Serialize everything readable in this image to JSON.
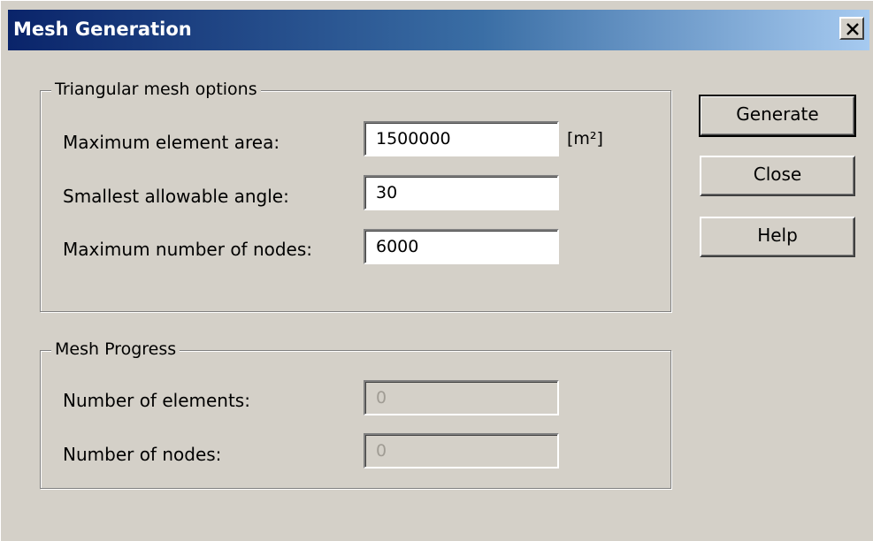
{
  "window": {
    "title": "Mesh Generation",
    "close_glyph": "×"
  },
  "triangular_group": {
    "legend": "Triangular mesh options",
    "fields": [
      {
        "label": "Maximum element area:",
        "value": "1500000",
        "unit": "[m²]"
      },
      {
        "label": "Smallest allowable angle:",
        "value": "30"
      },
      {
        "label": "Maximum number of nodes:",
        "value": "6000"
      }
    ]
  },
  "progress_group": {
    "legend": "Mesh Progress",
    "fields": [
      {
        "label": "Number of elements:",
        "value": "0"
      },
      {
        "label": "Number of nodes:",
        "value": "0"
      }
    ]
  },
  "buttons": {
    "generate": "Generate",
    "close": "Close",
    "help": "Help"
  },
  "colors": {
    "titlebar_start": "#0a246a",
    "titlebar_end": "#a6caf0",
    "dialog_bg": "#d4d0c8"
  }
}
